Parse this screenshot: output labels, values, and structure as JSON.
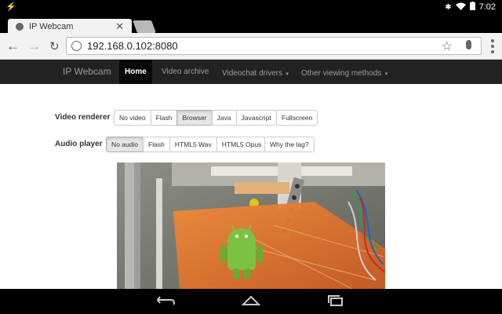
{
  "status_bar": {
    "time": "7:02"
  },
  "browser": {
    "tab_title": "IP Webcam",
    "url": "192.168.0.102:8080"
  },
  "site": {
    "brand": "IP Webcam",
    "nav": [
      "Home",
      "Video archive",
      "Videochat drivers",
      "Other viewing methods"
    ]
  },
  "video_renderer": {
    "label": "Video renderer",
    "options": [
      "No video",
      "Flash",
      "Browser",
      "Java",
      "Javascript"
    ],
    "selected": "Browser",
    "fullscreen": "Fullscreen"
  },
  "audio_player": {
    "label": "Audio player",
    "options": [
      "No audio",
      "Flash",
      "HTML5 Wav",
      "HTML5 Opus"
    ],
    "selected": "No audio",
    "lag_link": "Why the lag?"
  },
  "colors": {
    "navbar_bg": "#222222",
    "navbar_active": "#080808",
    "page_bg": "#ffffff",
    "printer_bed": "#e0782f",
    "android_green": "#7cc142"
  }
}
